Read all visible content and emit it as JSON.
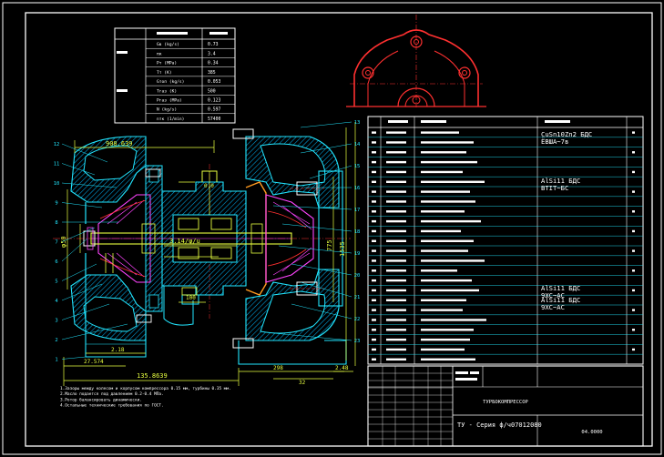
{
  "drawing": {
    "title": "ТУРБОКОМПРЕССОР",
    "designation": "ТУ - Серия ф/ч07012080",
    "sheet": "04.0000"
  },
  "params": {
    "rows": [
      {
        "label": "Gв (kg/s)",
        "value": "0.73"
      },
      {
        "label": "πк",
        "value": "3.4"
      },
      {
        "label": "Pт (MPa)",
        "value": "0.34"
      },
      {
        "label": "Tт (K)",
        "value": "385"
      },
      {
        "label": "Gтоп (kg/s)",
        "value": "0.053"
      },
      {
        "label": "Tгаз (K)",
        "value": "500"
      },
      {
        "label": "Pгаз (MPa)",
        "value": "0.123"
      },
      {
        "label": "N (kg/s)",
        "value": "0.597"
      },
      {
        "label": "nтк (1/min)",
        "value": "57400"
      }
    ]
  },
  "dimensions": {
    "top": "908.639",
    "bottom": "135.8639",
    "left_lower": "27.574",
    "left_mid": "2.18",
    "center": "3.14/ψ/u",
    "small": "0.0",
    "right_1": "775",
    "right_2": "1535",
    "bot_r1": "298",
    "bot_r2": "32",
    "bot_r3": "2.48",
    "phi": "φ50",
    "dim100": "100"
  },
  "balloons_left": [
    "12",
    "11",
    "10",
    "9",
    "8",
    "7",
    "6",
    "5",
    "4",
    "3",
    "2",
    "1"
  ],
  "balloons_right": [
    "13",
    "14",
    "15",
    "16",
    "17",
    "18",
    "19",
    "20",
    "21",
    "22",
    "23"
  ],
  "parts_list": {
    "materials": [
      {
        "text": "CuSn10Zn2   БДС"
      },
      {
        "text": "ЁВША~7в"
      },
      {
        "text": "AlSi11    БДС"
      },
      {
        "text": "ВТІТ~БС"
      },
      {
        "text": "AlSi11    БДС"
      },
      {
        "text": "9ХС~АС"
      },
      {
        "text": "AlSi11    БДС"
      },
      {
        "text": "9ХС~АС"
      }
    ]
  },
  "notes": [
    "1.Зазоры между колесом и корпусом компрессора 0.15 мм, турбины 0.35 мм.",
    "2.Масло подается под давлением 0.2-0.4 МПа.",
    "3.Ротор балансировать динамически.",
    "4.Остальные технические требования по ГОСТ."
  ],
  "colors": {
    "frame": "#ffffff",
    "outline": "#22e6ff",
    "hatch": "#00c8ff",
    "dim": "#e8ff40",
    "red": "#ff3030",
    "magenta": "#ff44ff",
    "orange": "#ff9a20"
  }
}
